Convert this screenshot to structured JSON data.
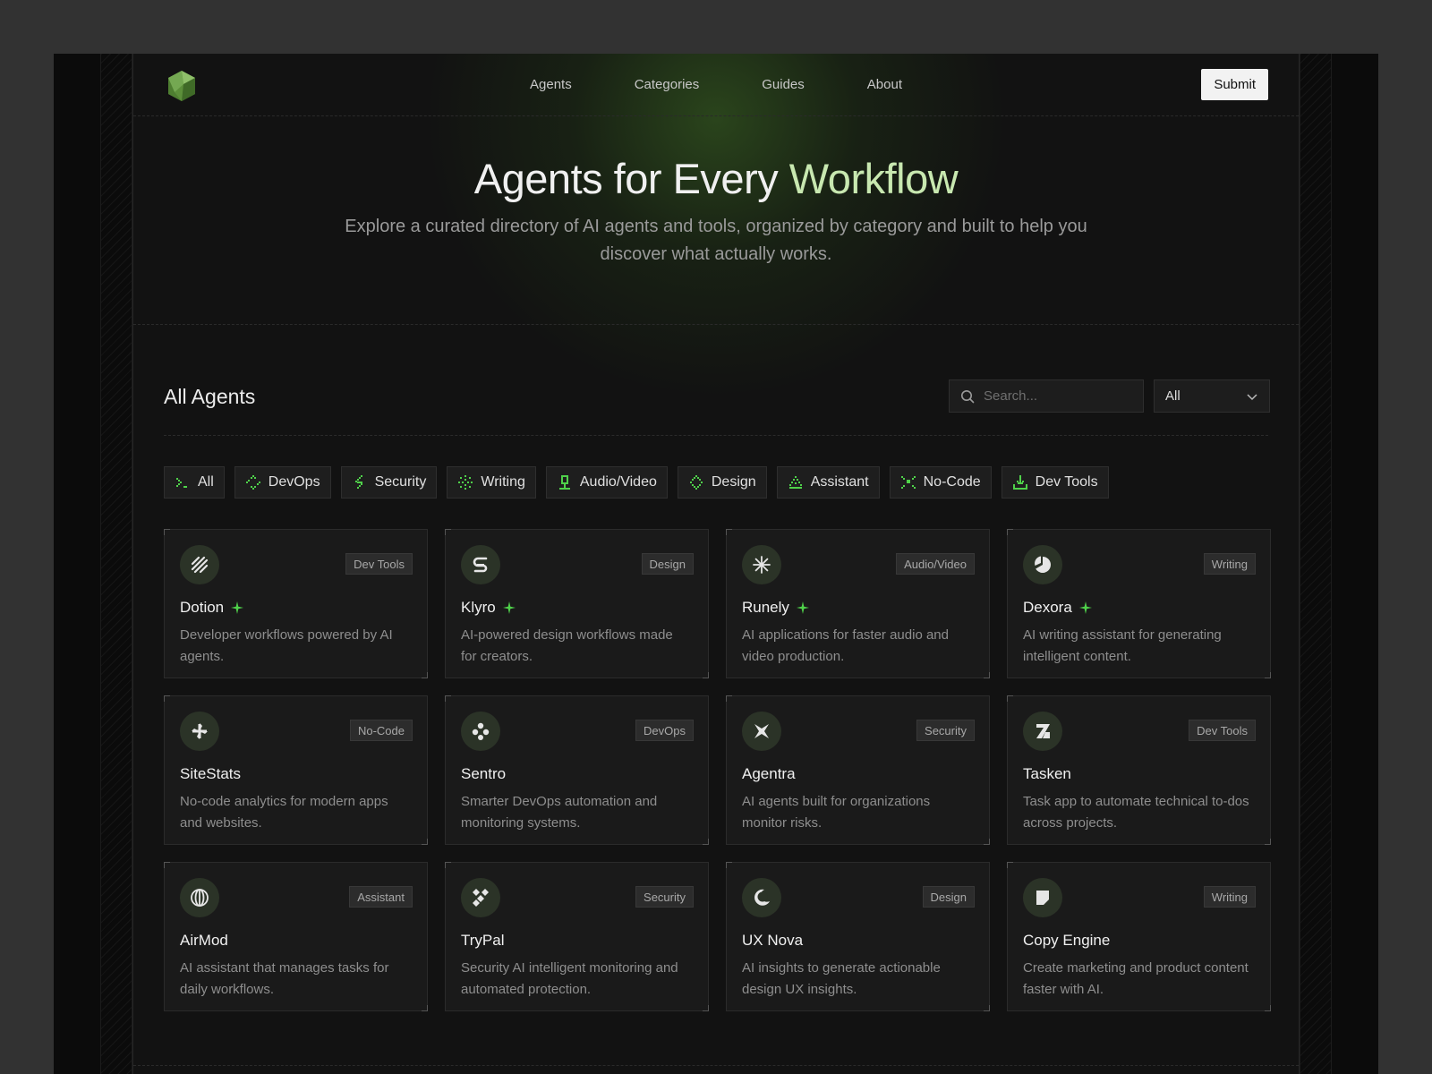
{
  "nav": {
    "items": [
      {
        "label": "Agents"
      },
      {
        "label": "Categories"
      },
      {
        "label": "Guides"
      },
      {
        "label": "About"
      }
    ],
    "submit_label": "Submit"
  },
  "hero": {
    "title_main": "Agents for Every ",
    "title_accent": "Workflow",
    "subtitle": "Explore a curated directory of AI agents and tools, organized by category and built to help you discover what actually works."
  },
  "listing": {
    "title": "All Agents",
    "search_placeholder": "Search...",
    "select_value": "All"
  },
  "filters": [
    {
      "label": "All"
    },
    {
      "label": "DevOps"
    },
    {
      "label": "Security"
    },
    {
      "label": "Writing"
    },
    {
      "label": "Audio/Video"
    },
    {
      "label": "Design"
    },
    {
      "label": "Assistant"
    },
    {
      "label": "No-Code"
    },
    {
      "label": "Dev Tools"
    }
  ],
  "agents": [
    {
      "name": "Dotion",
      "tag": "Dev Tools",
      "featured": true,
      "description": "Developer workflows powered by AI agents.",
      "icon": "stripes-icon"
    },
    {
      "name": "Klyro",
      "tag": "Design",
      "featured": true,
      "description": "AI-powered design workflows made for creators.",
      "icon": "s-curve-icon"
    },
    {
      "name": "Runely",
      "tag": "Audio/Video",
      "featured": true,
      "description": "AI applications for faster audio and video production.",
      "icon": "asterisk-icon"
    },
    {
      "name": "Dexora",
      "tag": "Writing",
      "featured": true,
      "description": "AI writing assistant for generating intelligent content.",
      "icon": "pie-icon"
    },
    {
      "name": "SiteStats",
      "tag": "No-Code",
      "featured": false,
      "description": "No-code analytics for modern apps and websites.",
      "icon": "pinwheel-icon"
    },
    {
      "name": "Sentro",
      "tag": "DevOps",
      "featured": false,
      "description": "Smarter DevOps automation and monitoring systems.",
      "icon": "nodes-icon"
    },
    {
      "name": "Agentra",
      "tag": "Security",
      "featured": false,
      "description": "AI agents built for organizations monitor risks.",
      "icon": "star-x-icon"
    },
    {
      "name": "Tasken",
      "tag": "Dev Tools",
      "featured": false,
      "description": "Task app to automate technical to-dos across projects.",
      "icon": "z-icon"
    },
    {
      "name": "AirMod",
      "tag": "Assistant",
      "featured": false,
      "description": "AI assistant that manages tasks for daily workflows.",
      "icon": "globe-icon"
    },
    {
      "name": "TryPal",
      "tag": "Security",
      "featured": false,
      "description": "Security AI intelligent monitoring and automated protection.",
      "icon": "diamonds-icon"
    },
    {
      "name": "UX Nova",
      "tag": "Design",
      "featured": false,
      "description": "AI insights to generate actionable design UX insights.",
      "icon": "crescent-icon"
    },
    {
      "name": "Copy Engine",
      "tag": "Writing",
      "featured": false,
      "description": "Create marketing and product content faster with AI.",
      "icon": "flag-icon"
    }
  ],
  "colors": {
    "accent_green": "#4fd14a",
    "hero_accent": "#c8e8b0",
    "background": "#121212"
  }
}
